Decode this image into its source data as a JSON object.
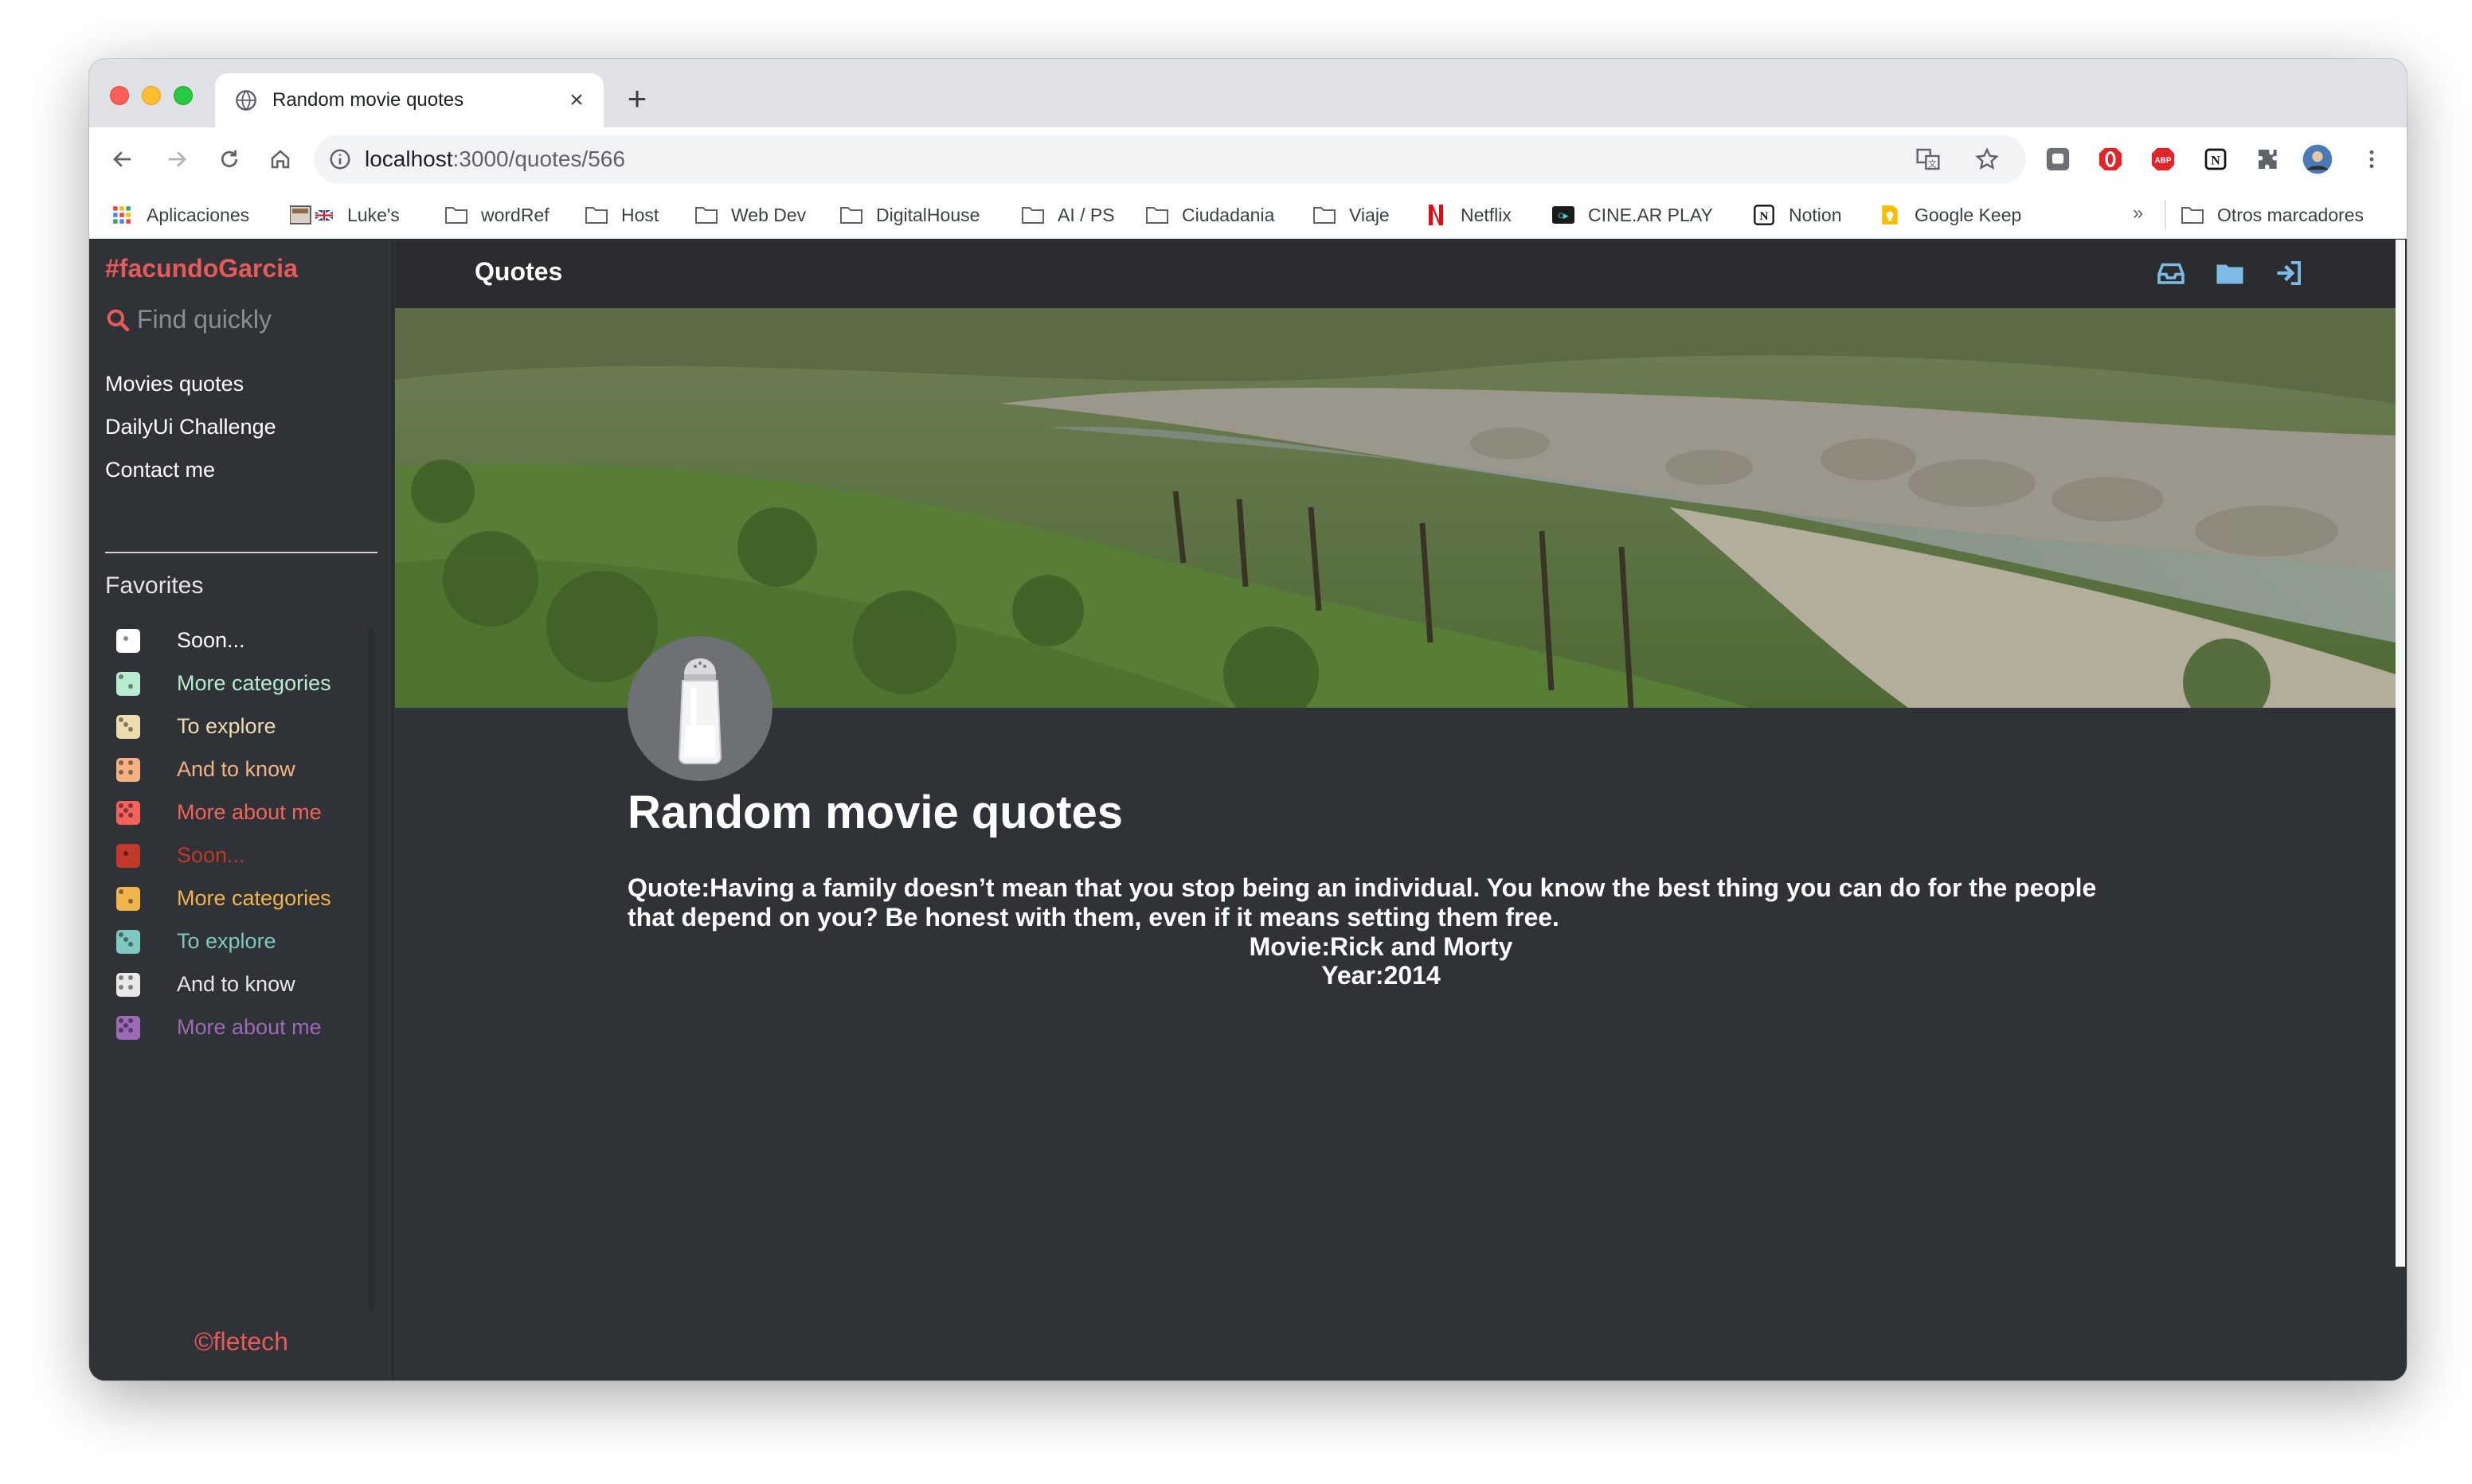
{
  "browser": {
    "tab_title": "Random movie quotes",
    "url_host": "localhost",
    "url_path": ":3000/quotes/566",
    "bookmarks": [
      {
        "label": "Aplicaciones",
        "icon": "apps-grid-icon"
      },
      {
        "label": "Luke's",
        "icon": "uk-flag-icon"
      },
      {
        "label": "wordRef",
        "icon": "folder-icon"
      },
      {
        "label": "Host",
        "icon": "folder-icon"
      },
      {
        "label": "Web Dev",
        "icon": "folder-icon"
      },
      {
        "label": "DigitalHouse",
        "icon": "folder-icon"
      },
      {
        "label": "AI / PS",
        "icon": "folder-icon"
      },
      {
        "label": "Ciudadania",
        "icon": "folder-icon"
      },
      {
        "label": "Viaje",
        "icon": "folder-icon"
      },
      {
        "label": "Netflix",
        "icon": "netflix-icon"
      },
      {
        "label": "CINE.AR PLAY",
        "icon": "cinear-icon"
      },
      {
        "label": "Notion",
        "icon": "notion-icon"
      },
      {
        "label": "Google Keep",
        "icon": "keep-icon"
      }
    ],
    "bookmarks_more": "»",
    "other_bookmarks": "Otros marcadores"
  },
  "sidebar": {
    "brand": "#facundoGarcia",
    "search_placeholder": "Find quickly",
    "nav": [
      "Movies quotes",
      "DailyUi Challenge",
      "Contact me"
    ],
    "favorites_title": "Favorites",
    "favorites": [
      {
        "label": "Soon...",
        "color": "#ffffff"
      },
      {
        "label": "More categories",
        "color": "#b8ecd0"
      },
      {
        "label": "To explore",
        "color": "#ecdcb0"
      },
      {
        "label": "And to know",
        "color": "#f4b184"
      },
      {
        "label": "More about me",
        "color": "#f2635c"
      },
      {
        "label": "Soon...",
        "color": "#c0392b"
      },
      {
        "label": "More categories",
        "color": "#f0b44c"
      },
      {
        "label": "To explore",
        "color": "#7ec8c0"
      },
      {
        "label": "And to know",
        "color": "#e8e8e8"
      },
      {
        "label": "More about me",
        "color": "#9b6bb5"
      }
    ],
    "footer": "©fletech"
  },
  "topbar": {
    "title": "Quotes",
    "icons": [
      "inbox-icon",
      "folder-icon",
      "sign-in-icon"
    ],
    "icon_color": "#7dbbe6"
  },
  "content": {
    "title": "Random movie quotes",
    "quote": "Quote:Having a family doesn’t mean that you stop being an individual. You know the best thing you can do for the people that depend on you? Be honest with them, even if it means setting them free.",
    "movie": "Movie:Rick and Morty",
    "year": "Year:2014"
  },
  "colors": {
    "brand": "#e85a5a",
    "page_bg": "#2f3236",
    "topbar_bg": "#2a2c30"
  }
}
